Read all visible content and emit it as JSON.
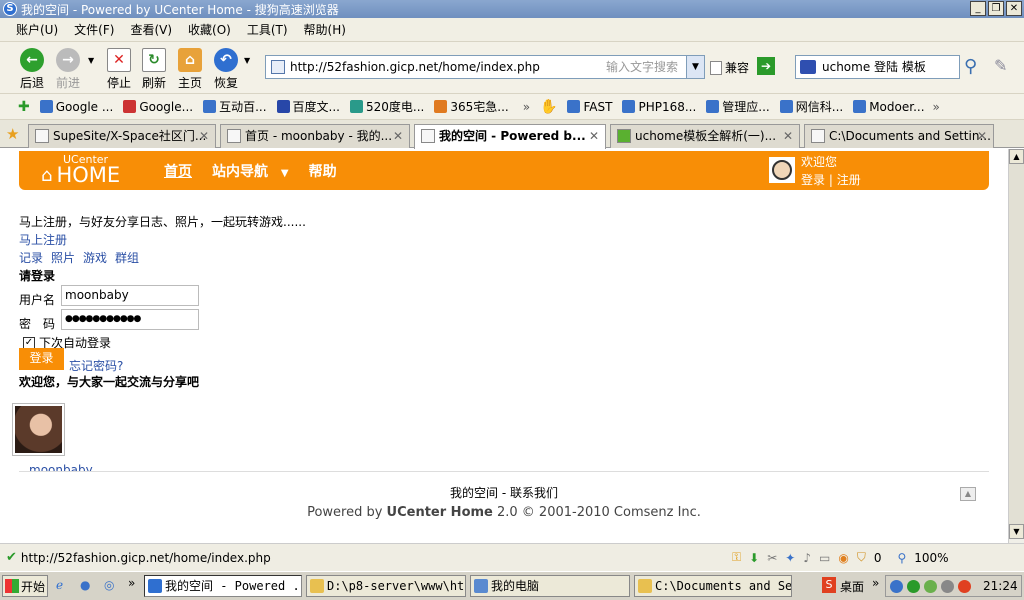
{
  "window": {
    "title": "我的空间 - Powered by UCenter Home - 搜狗高速浏览器",
    "icon": "sogou-icon"
  },
  "menu": [
    "账户(U)",
    "文件(F)",
    "查看(V)",
    "收藏(O)",
    "工具(T)",
    "帮助(H)"
  ],
  "toolbar": {
    "back": "后退",
    "forward": "前进",
    "stop": "停止",
    "refresh": "刷新",
    "home": "主页",
    "restore": "恢复",
    "address": "http://52fashion.gicp.net/home/index.php",
    "address_hint": "输入文字搜索",
    "compat": "兼容",
    "search_text": "uchome 登陆 模板"
  },
  "favorites": [
    "Google ...",
    "Google...",
    "互动百...",
    "百度文...",
    "520度电...",
    "365宅急...",
    "FAST",
    "PHP168...",
    "管理应...",
    "网信科...",
    "Modoer..."
  ],
  "tabs": [
    {
      "label": "SupeSite/X-Space社区门...",
      "active": false
    },
    {
      "label": "首页 - moonbaby - 我的...",
      "active": false
    },
    {
      "label": "我的空间 - Powered b...",
      "active": true
    },
    {
      "label": "uchome模板全解析(一)...",
      "active": false
    },
    {
      "label": "C:\\Documents and Settin...",
      "active": false
    }
  ],
  "page": {
    "logo_small": "UCenter",
    "logo_big": "HOME",
    "nav": [
      "首页",
      "站内导航",
      "帮助"
    ],
    "welcome": "欢迎您",
    "login_link": "登录",
    "sep": "|",
    "register_link": "注册",
    "intro": "马上注册，与好友分享日志、照片，一起玩转游戏......",
    "register_now": "马上注册",
    "features": [
      "记录",
      "照片",
      "游戏",
      "群组"
    ],
    "please_login": "请登录",
    "username_label": "用户名",
    "username_value": "moonbaby",
    "password_label": "密　码",
    "password_value": "●●●●●●●●●●●",
    "remember": "下次自动登录",
    "login_btn": "登录",
    "forgot": "忘记密码?",
    "welcome_msg": "欢迎您，与大家一起交流与分享吧",
    "member_name": "moonbaby",
    "footer_links": "我的空间 - 联系我们",
    "footer_powered_pre": "Powered by ",
    "footer_powered_brand": "UCenter Home",
    "footer_powered_post": " 2.0 © 2001-2010 Comsenz Inc."
  },
  "status": {
    "url": "http://52fashion.gicp.net/home/index.php",
    "count": "0",
    "zoom": "100%"
  },
  "taskbar": {
    "start": "开始",
    "tasks": [
      "我的空间 - Powered ...",
      "D:\\p8-server\\www\\ht...",
      "我的电脑",
      "C:\\Documents and Se..."
    ],
    "desktop": "桌面",
    "clock": "21:24"
  }
}
